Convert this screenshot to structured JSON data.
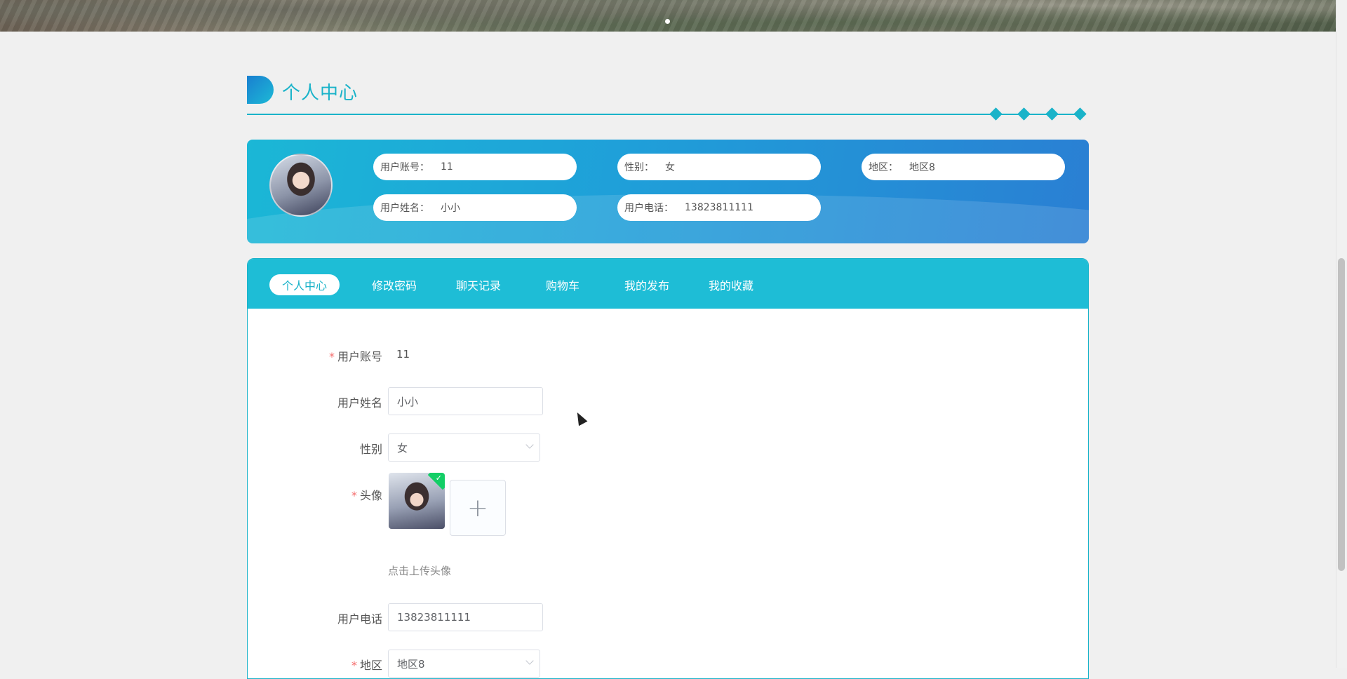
{
  "section": {
    "title": "个人中心"
  },
  "card": {
    "account_label": "用户账号：",
    "account_value": "11",
    "gender_label": "性别：",
    "gender_value": "女",
    "region_label": "地区：",
    "region_value": "地区8",
    "name_label": "用户姓名：",
    "name_value": "小小",
    "phone_label": "用户电话：",
    "phone_value": "13823811111"
  },
  "tabs": [
    {
      "label": "个人中心"
    },
    {
      "label": "修改密码"
    },
    {
      "label": "聊天记录"
    },
    {
      "label": "购物车"
    },
    {
      "label": "我的发布"
    },
    {
      "label": "我的收藏"
    }
  ],
  "form": {
    "required_mark": "*",
    "account_label": "用户账号",
    "account_value": "11",
    "name_label": "用户姓名",
    "name_value": "小小",
    "gender_label": "性别",
    "gender_value": "女",
    "avatar_label": "头像",
    "upload_plus": "+",
    "upload_hint": "点击上传头像",
    "phone_label": "用户电话",
    "phone_value": "13823811111",
    "region_label": "地区",
    "region_value": "地区8"
  },
  "icons": {
    "upload_check": "✓"
  },
  "colors": {
    "accent": "#1ab3c9",
    "tabbar": "#1ebdd6",
    "required": "#f56c6c",
    "success": "#13ce66"
  }
}
